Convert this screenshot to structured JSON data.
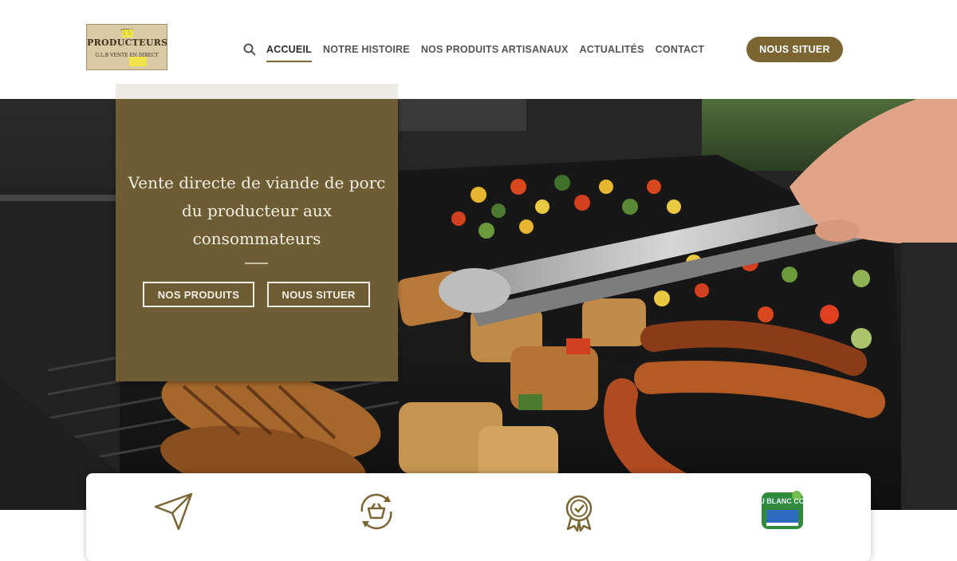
{
  "logo": {
    "line1": "TY",
    "line2": "PRODUCTEURS",
    "line3": "G.L.B VENTE EN DIRECT"
  },
  "nav": {
    "search_icon": "search-icon",
    "items": [
      {
        "label": "ACCUEIL",
        "active": true
      },
      {
        "label": "NOTRE HISTOIRE",
        "active": false
      },
      {
        "label": "NOS PRODUITS ARTISANAUX",
        "active": false
      },
      {
        "label": "ACTUALITÉS",
        "active": false
      },
      {
        "label": "CONTACT",
        "active": false
      }
    ],
    "cta": "NOUS SITUER"
  },
  "hero": {
    "title": "Vente directe de viande de porc du producteur aux consommateurs",
    "buttons": [
      "NOS PRODUITS",
      "NOUS SITUER"
    ]
  },
  "features": [
    {
      "icon": "paper-plane-icon"
    },
    {
      "icon": "basket-exchange-icon"
    },
    {
      "icon": "quality-badge-icon"
    },
    {
      "icon": "bleu-blanc-coeur-logo",
      "text": "BLEU BLANC COEUR"
    }
  ],
  "colors": {
    "accent": "#7a6533",
    "overlay": "#6d5c34",
    "text_light": "#f3efe4",
    "nav_text": "#555555"
  }
}
